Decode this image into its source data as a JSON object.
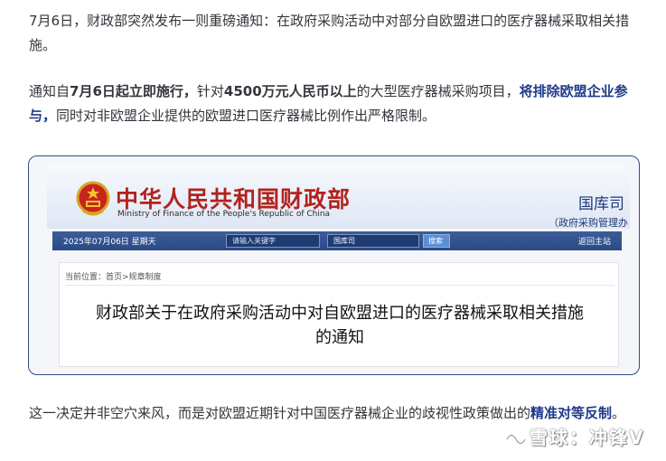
{
  "article": {
    "para1": "7月6日，财政部突然发布一则重磅通知：在政府采购活动中对部分自欧盟进口的医疗器械采取相关措施。",
    "para2": {
      "t1": "通知自",
      "b1": "7月6日起立即施行，",
      "t2": "针对",
      "b2": "4500万元人民币以上",
      "t3": "的大型医疗器械采购项目，",
      "b3": "将排除欧盟企业参与，",
      "t4": "同时对非欧盟企业提供的欧盟进口医疗器械比例作出严格限制。"
    },
    "para3": {
      "t1": "这一决定并非空穴来风，而是对欧盟近期针对中国医疗器械企业的歧视性政策做出的",
      "b1": "精准对等反制",
      "t2": "。"
    }
  },
  "screenshot": {
    "ministry_cn": "中华人民共和国财政部",
    "ministry_en": "Ministry of Finance of the People's Republic of China",
    "dept": "国库司",
    "dept_sub": "（政府采购管理办公室）",
    "nav": {
      "date": "2025年07月06日  星期天",
      "search_placeholder": "请输入关键字",
      "dept_select": "国库司",
      "search_button": "搜索",
      "back_home": "返回主站"
    },
    "breadcrumb": "当前位置：首页>规章制度",
    "notice_title_line1": "财政部关于在政府采购活动中对自欧盟进口的医疗器械采取相关措施",
    "notice_title_line2": "的通知"
  },
  "watermark": {
    "text": "雪球：冲锋V",
    "icon": "snowball-logo-icon"
  },
  "colors": {
    "link": "#1f3a8a",
    "ministry_red": "#b3221d",
    "navbar": "#2a4a86",
    "card_border": "#2f4d8a"
  }
}
